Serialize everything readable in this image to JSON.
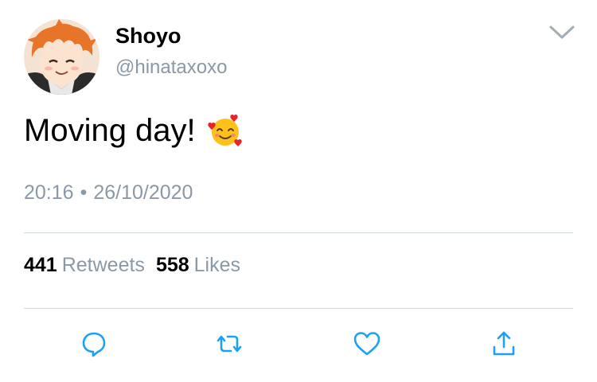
{
  "author": {
    "display_name": "Shoyo",
    "handle": "@hinataxoxo",
    "avatar_icon": "anime-avatar-icon"
  },
  "tweet": {
    "text": "Moving day!",
    "emoji_icon": "smiling-face-with-hearts-emoji",
    "time": "20:16",
    "separator": "•",
    "date": "26/10/2020"
  },
  "stats": {
    "retweets_count": "441",
    "retweets_label": "Retweets",
    "likes_count": "558",
    "likes_label": "Likes"
  },
  "actions": {
    "reply_icon": "reply-icon",
    "retweet_icon": "retweet-icon",
    "like_icon": "heart-icon",
    "share_icon": "share-icon"
  },
  "colors": {
    "secondary_text": "#8b98a5",
    "divider": "#cfd9de",
    "icon_blue": "#1da1f2"
  }
}
